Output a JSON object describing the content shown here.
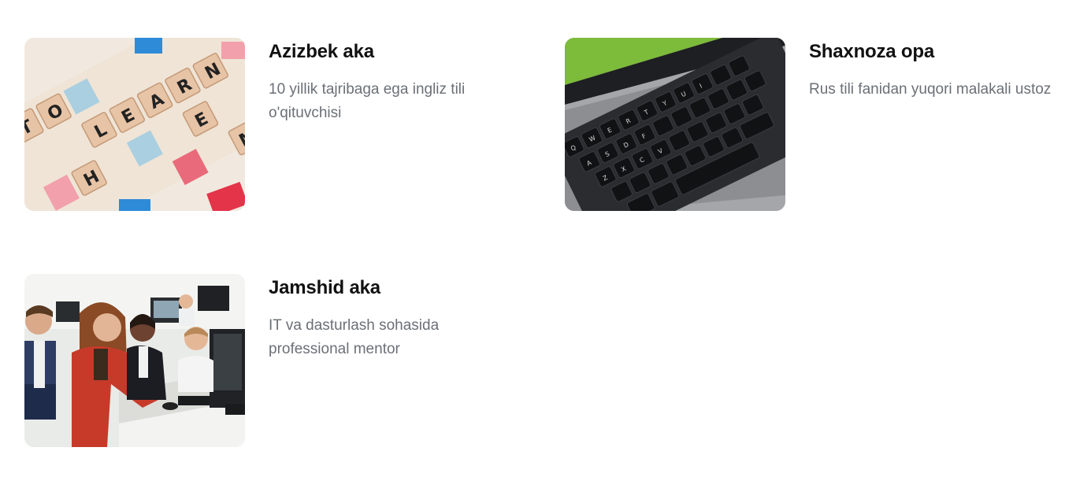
{
  "mentors": [
    {
      "name": "Azizbek aka",
      "description": "10 yillik tajribaga ega ingliz tili o'qituvchisi",
      "image": "scrabble-tiles-learn-photo"
    },
    {
      "name": "Shaxnoza opa",
      "description": "Rus tili fanidan yuqori malakali ustoz",
      "image": "laptop-keyboard-photo"
    },
    {
      "name": "Jamshid aka",
      "description": "IT va dasturlash sohasida professional mentor",
      "image": "classroom-computers-photo"
    }
  ]
}
